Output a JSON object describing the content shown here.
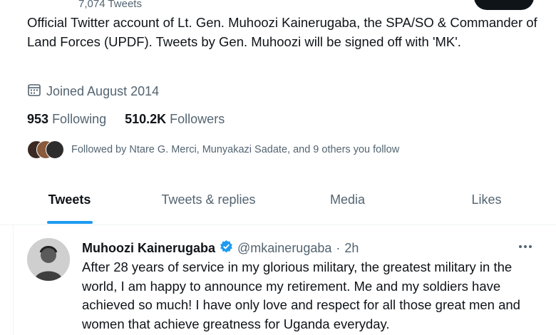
{
  "profile": {
    "tweet_count": "7,074 Tweets",
    "bio": "Official Twitter account of Lt. Gen. Muhoozi Kainerugaba, the SPA/SO & Commander of Land Forces (UPDF). Tweets by Gen. Muhoozi will be signed off with 'MK'.",
    "joined": "Joined August 2014",
    "following_count": "953",
    "following_label": "Following",
    "followers_count": "510.2K",
    "followers_label": "Followers",
    "followed_by": "Followed by Ntare G. Merci, Munyakazi Sadate, and 9 others you follow"
  },
  "tabs": [
    {
      "label": "Tweets",
      "active": true
    },
    {
      "label": "Tweets & replies",
      "active": false
    },
    {
      "label": "Media",
      "active": false
    },
    {
      "label": "Likes",
      "active": false
    }
  ],
  "tweet": {
    "author_name": "Muhoozi Kainerugaba",
    "handle": "@mkainerugaba",
    "separator": "·",
    "time": "2h",
    "text": "After 28 years of service in my glorious military, the greatest military in the world, I am happy to announce my retirement. Me and my soldiers have achieved so much! I have only love and respect for all those great men and women that achieve greatness for Uganda everyday."
  },
  "icons": {
    "calendar": "calendar-icon",
    "verified": "verified-badge-icon",
    "more": "more-options-icon"
  },
  "colors": {
    "accent": "#1d9bf0",
    "text": "#0f1419",
    "muted": "#536471",
    "border": "#eff3f4"
  }
}
